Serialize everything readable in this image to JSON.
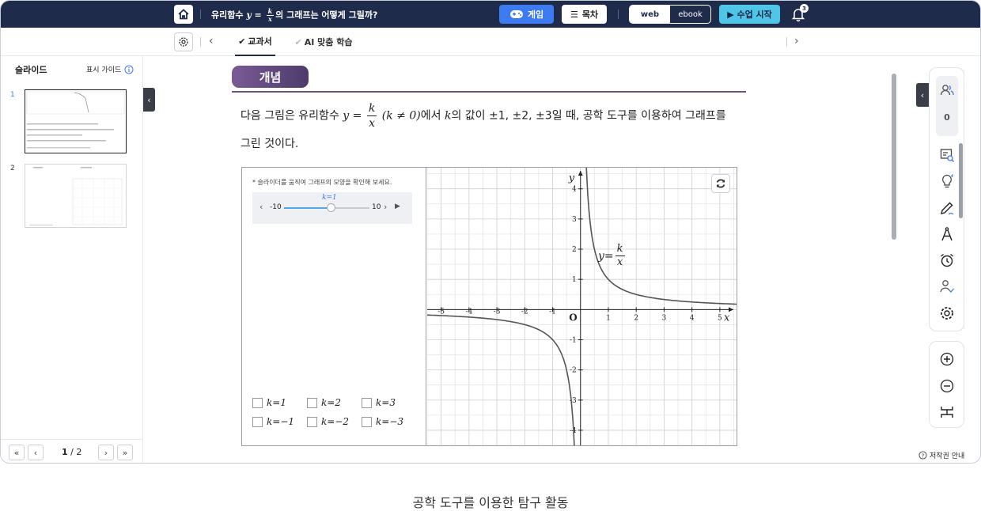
{
  "header": {
    "home_icon": "home-icon",
    "title_prefix": "유리함수 ",
    "title_math_y": "y",
    "title_eq": " = ",
    "title_frac_num": "k",
    "title_frac_den": "x",
    "title_suffix": "의 그래프는 어떻게 그릴까?",
    "game_label": "게임",
    "toc_label": "목차",
    "web_label": "web",
    "ebook_label": "ebook",
    "start_label": "▶ 수업 시작",
    "notification_count": "3"
  },
  "tabs": {
    "textbook": "교과서",
    "ai_learning": "AI 맞춤 학습"
  },
  "sidebar": {
    "title": "슬라이드",
    "guide_label": "표시 가이드",
    "slides": [
      {
        "number": "1"
      },
      {
        "number": "2"
      }
    ],
    "page_current": "1",
    "page_sep": " / ",
    "page_total": "2"
  },
  "content": {
    "badge": "개념",
    "text_1": "다음 그림은 유리함수 ",
    "text_math_y": "y",
    "text_eq": " = ",
    "text_frac_num": "k",
    "text_frac_den": "x",
    "text_cond": " (k ≠ 0)",
    "text_2": "에서 ",
    "text_math_k": "k",
    "text_3": "의 값이 ±1, ±2, ±3일 때, 공학 도구를 이용하여 그래프를",
    "text_4": "그린 것이다."
  },
  "widget": {
    "hint": "* 슬라이더를 움직여 그래프의 모양을 확인해 보세요.",
    "slider_label": "k=1",
    "slider_min": "-10",
    "slider_max": "10",
    "slider_value": 1,
    "slider_range": [
      -10,
      10
    ],
    "checkboxes": [
      "k=1",
      "k=2",
      "k=3",
      "k=−1",
      "k=−2",
      "k=−3"
    ],
    "graph_label_y": "y",
    "graph_label_eq": " = ",
    "graph_label_num": "k",
    "graph_label_den": "x"
  },
  "chart_data": {
    "type": "line",
    "function": "y = k/x",
    "k": 1,
    "xlim": [
      -5.5,
      5.6
    ],
    "ylim": [
      -4.5,
      4.7
    ],
    "x_ticks": [
      "-5",
      "-4",
      "-3",
      "-2",
      "-1",
      "1",
      "2",
      "3",
      "4",
      "5"
    ],
    "y_ticks": [
      "4",
      "3",
      "2",
      "1",
      "-1",
      "-2",
      "-3",
      "-4"
    ],
    "origin_label": "O",
    "x_axis_label": "x",
    "y_axis_label": "y",
    "grid": true,
    "line_color": "#555555"
  },
  "right_tools": {
    "user_count": "0",
    "icons": [
      "users-icon",
      "search-doc-icon",
      "bulb-icon",
      "pen-icon",
      "compass-icon",
      "alarm-icon",
      "person-check-icon",
      "gear-icon"
    ],
    "zoom_icons": [
      "zoom-in-icon",
      "zoom-out-icon",
      "fit-width-icon"
    ]
  },
  "footer": {
    "copyright": "저작권 안내"
  },
  "caption": "공학 도구를 이용한 탐구 활동",
  "colors": {
    "topbar": "#1f2b4b",
    "accent_blue": "#3e7bf0",
    "start_cyan": "#4fc6e8",
    "concept_purple": "#6b5185"
  }
}
